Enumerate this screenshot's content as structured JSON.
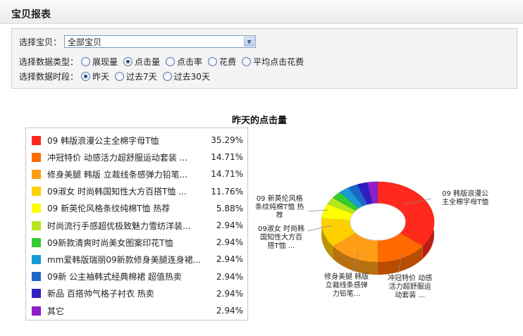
{
  "header": {
    "title": "宝贝报表"
  },
  "filters": {
    "product_label": "选择宝贝：",
    "product_selected": "全部宝贝",
    "type_label": "选择数据类型：",
    "type_options": [
      {
        "label": "展现量",
        "selected": false
      },
      {
        "label": "点击量",
        "selected": true
      },
      {
        "label": "点击率",
        "selected": false
      },
      {
        "label": "花费",
        "selected": false
      },
      {
        "label": "平均点击花费",
        "selected": false
      }
    ],
    "period_label": "选择数据时段：",
    "period_options": [
      {
        "label": "昨天",
        "selected": true
      },
      {
        "label": "过去7天",
        "selected": false
      },
      {
        "label": "过去30天",
        "selected": false
      }
    ]
  },
  "chart_data": {
    "type": "pie",
    "title": "昨天的点击量",
    "categories": [
      "09 韩版浪漫公主全棉字母T恤",
      "冲冠特价 动感活力超舒服运动套装 ...",
      "修身美腿 韩版 立裁线条感弹力铅笔...",
      "09淑女 时尚韩国知性大方百搭T恤 ...",
      "09 新英伦风格条纹纯棉T恤 热荐",
      "时尚流行手感超优极致魅力雪纺洋装...",
      "09新款清爽时尚美女图案印花T恤",
      "mm爱韩版瑞丽09新款修身美腿连身裙...",
      "09新 公主袖韩式经典棉裙 超值热卖",
      "新品 百搭帅气格子衬衣 热卖",
      "其它"
    ],
    "values": [
      35.29,
      14.71,
      14.71,
      11.76,
      5.88,
      2.94,
      2.94,
      2.94,
      2.94,
      2.94,
      2.94
    ],
    "value_labels": [
      "35.29%",
      "14.71%",
      "14.71%",
      "11.76%",
      "5.88%",
      "2.94%",
      "2.94%",
      "2.94%",
      "2.94%",
      "2.94%",
      "2.94%"
    ],
    "colors": [
      "#ff2a1d",
      "#ff6a00",
      "#ff9d17",
      "#ffd000",
      "#ffff00",
      "#b5e61d",
      "#33cc33",
      "#1a9ad6",
      "#1d66c8",
      "#2f1ec0",
      "#8d1ec8"
    ],
    "callouts": [
      {
        "text": [
          "09 韩版浪漫公",
          "主全棉字母T恤"
        ]
      },
      {
        "text": [
          "冲冠特价 动感",
          "活力超舒服运",
          "动套装 ..."
        ]
      },
      {
        "text": [
          "修身美腿 韩版",
          "立裁线条感弹",
          "力铅笔..."
        ]
      },
      {
        "text": [
          "09淑女 时尚韩",
          "国知性大方百",
          "搭T恤 ..."
        ]
      },
      {
        "text": [
          "09 新英伦风格",
          "条纹纯棉T恤 热",
          "荐"
        ]
      }
    ],
    "legend_placement": "left",
    "style": "3d-donut"
  }
}
